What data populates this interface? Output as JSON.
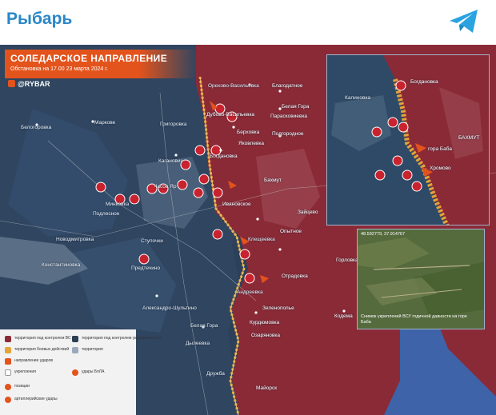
{
  "header": {
    "channel_name": "Рыбарь"
  },
  "map": {
    "title": "СОЛЕДАРСКОЕ НАПРАВЛЕНИЕ",
    "subtitle": "Обстановка на 17.00 23 марта 2024 г.",
    "brand": "@RYBAR",
    "colors": {
      "russian_control": "#8b2a37",
      "ukrainian_territory": "#2c3e55",
      "front_line": "#e3a43a",
      "accent": "#e3531c",
      "water": "#3e63a8"
    },
    "places": [
      {
        "id": "belogorovka",
        "name": "Белогоровка"
      },
      {
        "id": "markovo",
        "name": "Маркове"
      },
      {
        "id": "grigorovka",
        "name": "Григоровка"
      },
      {
        "id": "orekhovo-vasilevka",
        "name": "Орехово-Васильевка"
      },
      {
        "id": "blagodatnoe",
        "name": "Благодатное"
      },
      {
        "id": "belaya-gora",
        "name": "Белая Гора"
      },
      {
        "id": "dubovo-vasilevka",
        "name": "Дубово-Васильевка"
      },
      {
        "id": "paraskoveevka",
        "name": "Парасковиевка"
      },
      {
        "id": "berkhovka",
        "name": "Берховка"
      },
      {
        "id": "podgorodnoe",
        "name": "Подгородное"
      },
      {
        "id": "yakovlevka",
        "name": "Яковлевка"
      },
      {
        "id": "kaganovich",
        "name": "Каганович"
      },
      {
        "id": "bogdanovka",
        "name": "Богдановка"
      },
      {
        "id": "bakhmut",
        "name": "Бахмут"
      },
      {
        "id": "chasov-yar",
        "name": "Часов Яр"
      },
      {
        "id": "ivanovskoe",
        "name": "Ивановское"
      },
      {
        "id": "podlesnoe",
        "name": "Подлесное"
      },
      {
        "id": "minkovka",
        "name": "Минковка"
      },
      {
        "id": "stupochki",
        "name": "Ступочки"
      },
      {
        "id": "predtechino",
        "name": "Предтечино"
      },
      {
        "id": "konstantinovka",
        "name": "Константиновка"
      },
      {
        "id": "novodmitrovka",
        "name": "Новодмитровка"
      },
      {
        "id": "klescheevka",
        "name": "Клещеевка"
      },
      {
        "id": "andreevka",
        "name": "Андреевка"
      },
      {
        "id": "otradovka",
        "name": "Отрадовка"
      },
      {
        "id": "zelenopolye",
        "name": "Зеленополье"
      },
      {
        "id": "kurdyumovka",
        "name": "Курдюмовка"
      },
      {
        "id": "ozaryanovka",
        "name": "Озаряновка"
      },
      {
        "id": "aleksandro-shultino",
        "name": "Александро-Шультино"
      },
      {
        "id": "belaya-gora-2",
        "name": "Белая Гора"
      },
      {
        "id": "dyleevka",
        "name": "Дылеевка"
      },
      {
        "id": "druzhba",
        "name": "Дружба"
      },
      {
        "id": "mayorsk",
        "name": "Майорск"
      },
      {
        "id": "kodema",
        "name": "Кодема"
      },
      {
        "id": "gorlovka",
        "name": "Горловка"
      },
      {
        "id": "opytnoe",
        "name": "Опытное"
      },
      {
        "id": "zaitsevo",
        "name": "Зайцево"
      }
    ],
    "inset_top": {
      "places": [
        {
          "id": "kalinovka",
          "name": "Калиновка"
        },
        {
          "id": "bogdanovka-inset",
          "name": "Богдановка"
        },
        {
          "id": "gora-baba",
          "name": "гора Баба"
        },
        {
          "id": "khromovo",
          "name": "Хромово"
        },
        {
          "id": "bakhmut-inset",
          "name": "БАХМУТ"
        }
      ]
    },
    "inset_sat": {
      "coords": "48.592779, 37.914767",
      "caption": "Снимок укреплений ВСУ годичной давности на горе Баба"
    },
    "legend": {
      "items": [
        {
          "label": "территория под контролем ВС РФ",
          "color": "#8b2a37"
        },
        {
          "label": "территория боевых действий",
          "color": "#e3a43a"
        },
        {
          "label": "направление ударов",
          "color": "#e3531c"
        },
        {
          "label": "укрепления",
          "color": "#ffffff"
        },
        {
          "label": "территория под контролем украинских сил",
          "color": "#2c3e55"
        },
        {
          "label": "территория",
          "color": "#9aa9bb"
        },
        {
          "label": "позиции",
          "color": "#e3531c"
        },
        {
          "label": "удары БпЛА",
          "color": "#e3531c"
        },
        {
          "label": "артиллерийские удары",
          "color": "#e3531c"
        }
      ]
    }
  }
}
